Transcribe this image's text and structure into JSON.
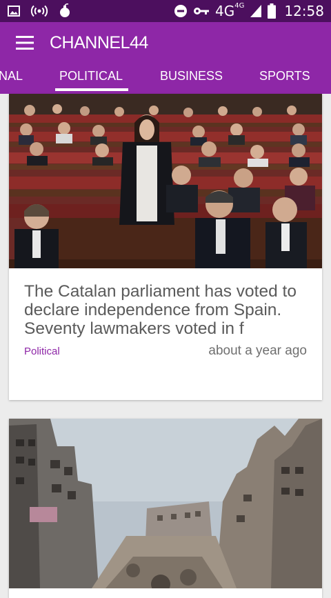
{
  "status_bar": {
    "network": "4G",
    "network_sup": "4G",
    "time": "12:58",
    "icons": [
      "image-icon",
      "broadcast-icon",
      "bomb-icon",
      "do-not-disturb-icon",
      "key-icon",
      "signal-icon",
      "battery-icon"
    ]
  },
  "toolbar": {
    "title": "CHANNEL44",
    "menu_icon": "hamburger-icon"
  },
  "tabs": [
    {
      "label": "NAL"
    },
    {
      "label": "POLITICAL",
      "selected": true
    },
    {
      "label": "BUSINESS"
    },
    {
      "label": "SPORTS"
    }
  ],
  "articles": [
    {
      "image": "parliament-photo",
      "headline": "The Catalan parliament has voted to declare independence from Spain.  Seventy lawmakers voted in f",
      "category": "Political",
      "time": "about a year ago"
    },
    {
      "image": "ruined-city-photo"
    }
  ],
  "colors": {
    "status_bar": "#4c0f5e",
    "toolbar": "#8e27a7",
    "accent": "#8e27a7",
    "background": "#ececec"
  }
}
